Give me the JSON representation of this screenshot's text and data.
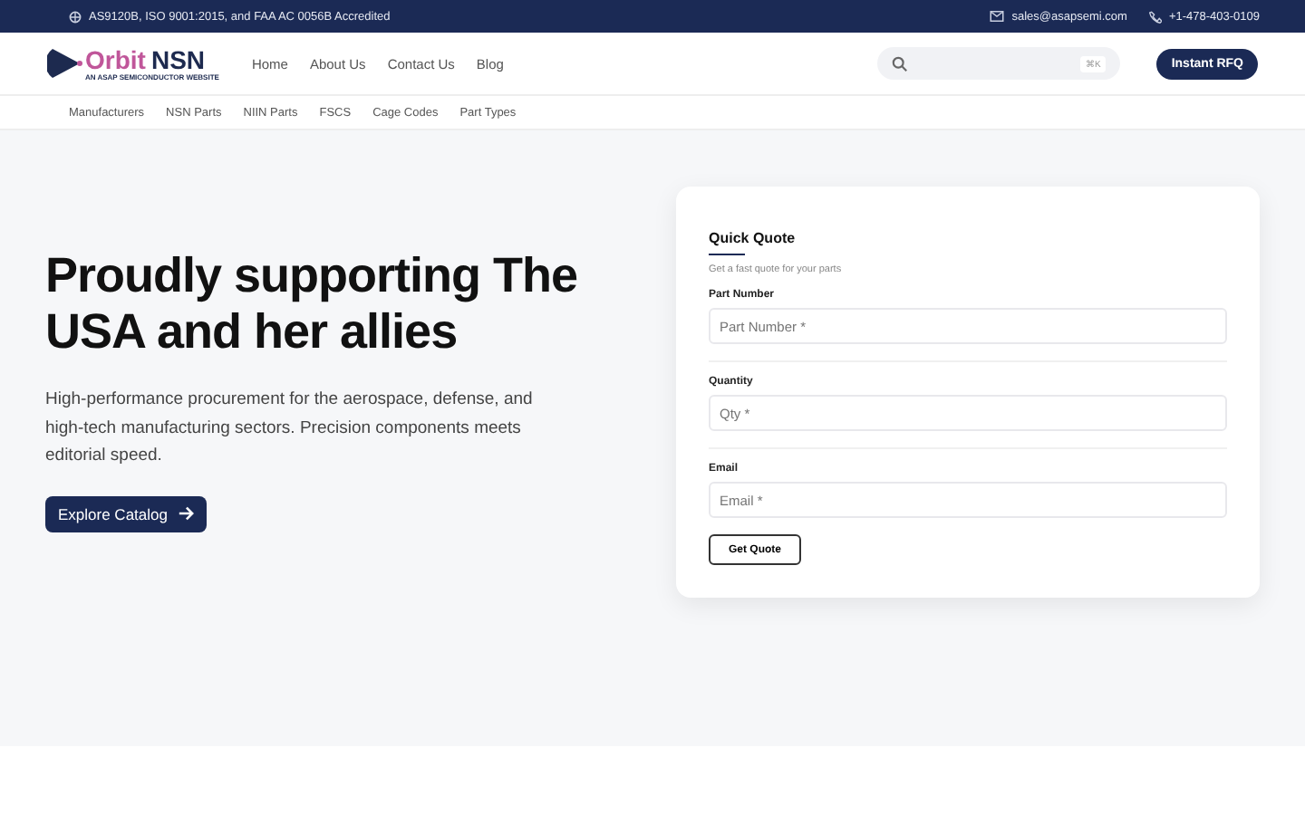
{
  "top_bar": {
    "accreditation": "AS9120B, ISO 9001:2015, and FAA AC 0056B Accredited",
    "email": "sales@asapsemi.com",
    "phone": "+1-478-403-0109"
  },
  "logo": {
    "word_1": "Orbit",
    "word_2": "NSN",
    "tagline": "AN ASAP SEMICONDUCTOR WEBSITE"
  },
  "nav": [
    "Home",
    "About Us",
    "Contact Us",
    "Blog"
  ],
  "search": {
    "shortcut": "⌘K"
  },
  "rfq_button": "Instant RFQ",
  "sub_nav": [
    "Manufacturers",
    "NSN Parts",
    "NIIN Parts",
    "FSCS",
    "Cage Codes",
    "Part Types"
  ],
  "hero": {
    "title": "Proudly supporting The USA and her allies",
    "text": "High-performance procurement for the aerospace, defense, and high-tech manufacturing sectors. Precision components meets editorial speed.",
    "button": "Explore Catalog"
  },
  "quote": {
    "title": "Quick Quote",
    "subtitle": "Get a fast quote for your parts",
    "fields": [
      {
        "label": "Part Number",
        "placeholder": "Part Number *"
      },
      {
        "label": "Quantity",
        "placeholder": "Qty *"
      },
      {
        "label": "Email",
        "placeholder": "Email *"
      }
    ],
    "button": "Get Quote"
  }
}
